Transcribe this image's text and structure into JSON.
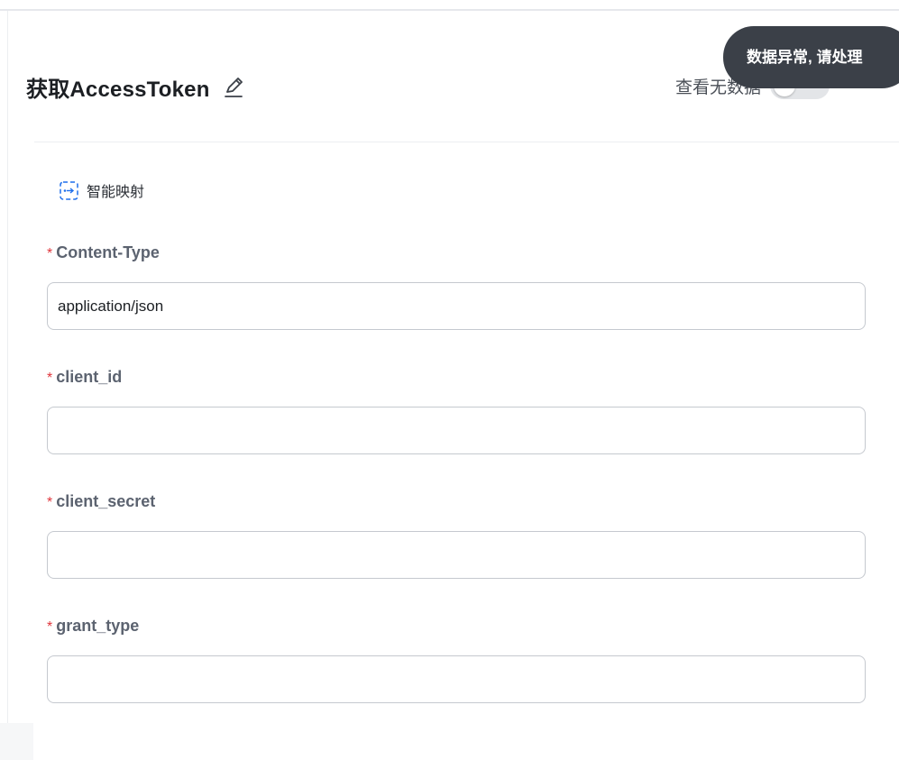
{
  "header": {
    "title": "获取AccessToken",
    "view_toggle_label": "查看无数据",
    "view_toggle_on": false
  },
  "tooltip": {
    "text": "数据异常, 请处理"
  },
  "smart_map": {
    "label": "智能映射",
    "icon": "smart-map-icon"
  },
  "fields": [
    {
      "label": "Content-Type",
      "required": true,
      "value": "application/json"
    },
    {
      "label": "client_id",
      "required": true,
      "value": ""
    },
    {
      "label": "client_secret",
      "required": true,
      "value": ""
    },
    {
      "label": "grant_type",
      "required": true,
      "value": ""
    }
  ],
  "required_mark": "*",
  "colors": {
    "accent": "#1f6feb",
    "required": "#e0363d",
    "tooltip_bg": "#3b4048"
  }
}
